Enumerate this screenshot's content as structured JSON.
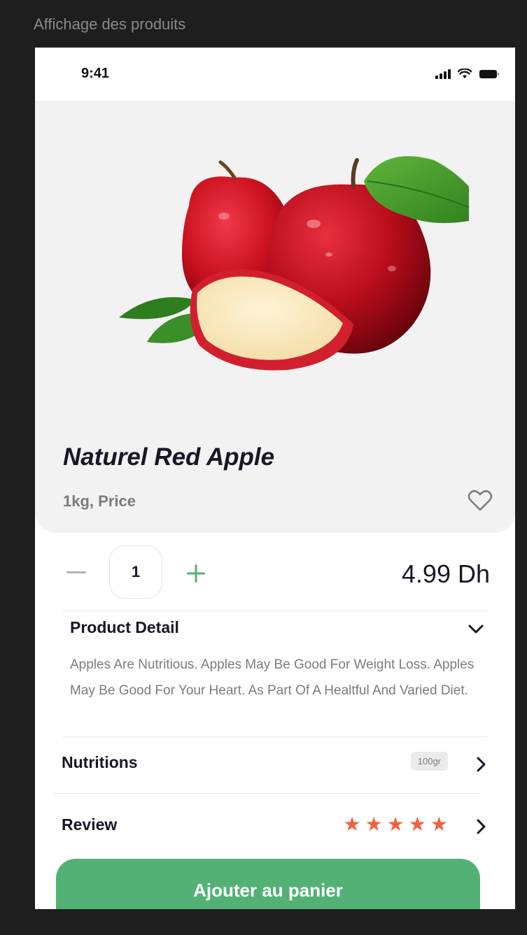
{
  "frame": {
    "label": "Affichage des produits"
  },
  "status_bar": {
    "time": "9:41"
  },
  "product": {
    "title": "Naturel Red Apple",
    "subtitle": "1kg, Price",
    "quantity": "1",
    "price": "4.99 Dh"
  },
  "detail": {
    "title": "Product Detail",
    "text": "Apples Are Nutritious. Apples May Be Good For Weight Loss. Apples May Be Good For Your Heart. As Part Of A Healtful And Varied Diet."
  },
  "nutritions": {
    "label": "Nutritions",
    "badge": "100gr"
  },
  "review": {
    "label": "Review",
    "rating": 5,
    "max_rating": 5
  },
  "cta": {
    "label": "Ajouter au panier"
  },
  "icons": {
    "heart": "heart-outline-icon",
    "minus": "minus-icon",
    "plus": "plus-icon",
    "chevron_down": "chevron-down-icon",
    "chevron_right": "chevron-right-icon",
    "star": "star-icon"
  },
  "colors": {
    "accent_green": "#53b175",
    "star_orange": "#f3603f",
    "text_dark": "#181725",
    "text_muted": "#7c7c7c",
    "hero_bg": "#f2f2f2"
  }
}
